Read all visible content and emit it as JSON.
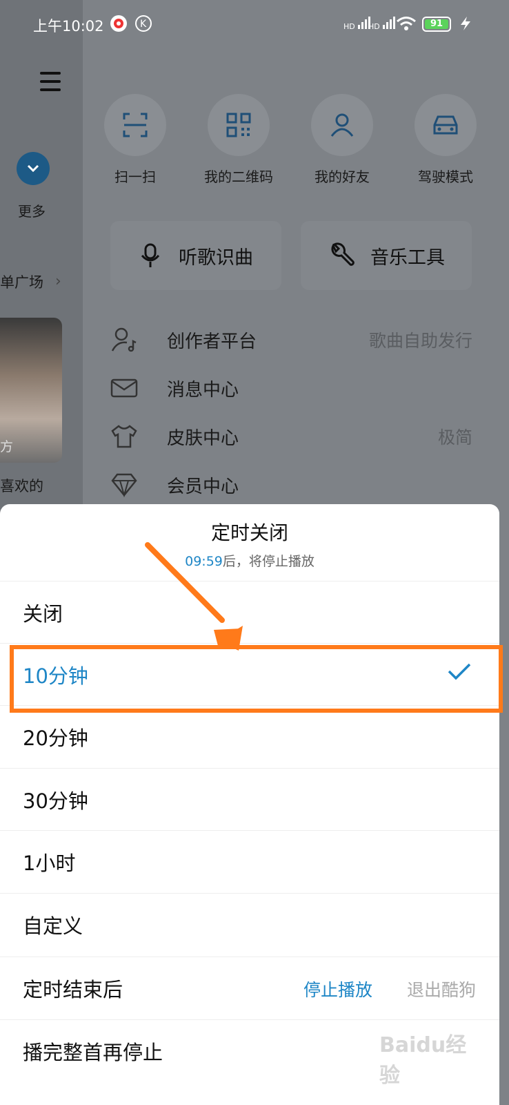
{
  "status_bar": {
    "time": "上午10:02",
    "battery": "91",
    "hd1": "HD",
    "hd2": "HD"
  },
  "sidebar": {
    "more": "更多",
    "square": "单广场",
    "liked": "喜欢的",
    "photo_caption": "方"
  },
  "quick_actions": [
    {
      "label": "扫一扫",
      "icon": "scan-icon"
    },
    {
      "label": "我的二维码",
      "icon": "qrcode-icon"
    },
    {
      "label": "我的好友",
      "icon": "user-icon"
    },
    {
      "label": "驾驶模式",
      "icon": "car-icon"
    }
  ],
  "tools": [
    {
      "label": "听歌识曲",
      "icon": "mic-icon"
    },
    {
      "label": "音乐工具",
      "icon": "wrench-icon"
    }
  ],
  "menu_list": [
    {
      "label": "创作者平台",
      "right": "歌曲自助发行",
      "icon": "creator-icon"
    },
    {
      "label": "消息中心",
      "right": "",
      "icon": "mail-icon"
    },
    {
      "label": "皮肤中心",
      "right": "极简",
      "icon": "shirt-icon"
    },
    {
      "label": "会员中心",
      "right": "",
      "icon": "diamond-icon"
    }
  ],
  "sheet": {
    "title": "定时关闭",
    "remaining_time": "09:59",
    "remaining_suffix": "后，将停止播放",
    "options": [
      "关闭",
      "10分钟",
      "20分钟",
      "30分钟",
      "1小时",
      "自定义"
    ],
    "selected_option": "10分钟",
    "after_end_label": "定时结束后",
    "after_end_choice1": "停止播放",
    "after_end_choice2": "退出酷狗",
    "finish_song_label": "播完整首再停止"
  },
  "colors": {
    "accent": "#1e86c6",
    "highlight": "#ff7a1a"
  },
  "watermark": "Baidu经验"
}
